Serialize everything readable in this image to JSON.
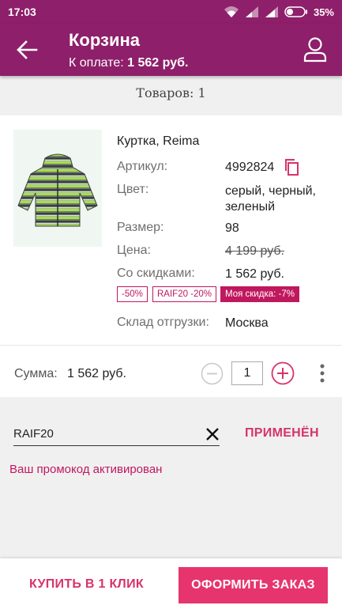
{
  "status_bar": {
    "time": "17:03",
    "battery": "35%"
  },
  "app_bar": {
    "title": "Корзина",
    "subtitle_label": "К оплате:",
    "subtitle_value": "1 562 руб."
  },
  "items_count": "Товаров: 1",
  "product": {
    "name": "Куртка, Reima",
    "fields": {
      "article_label": "Артикул:",
      "article_value": "4992824",
      "color_label": "Цвет:",
      "color_value_1": "серый, черный,",
      "color_value_2": "зеленый",
      "size_label": "Размер:",
      "size_value": "98",
      "price_label": "Цена:",
      "price_value": "4 199 руб.",
      "discount_label": "Со скидками:",
      "discount_value": "1 562 руб.",
      "warehouse_label": "Склад отгрузки:",
      "warehouse_value": "Москва"
    },
    "tags": [
      "-50%",
      "RAIF20 -20%",
      "Моя скидка: -7%"
    ]
  },
  "summary": {
    "label": "Сумма:",
    "value": "1 562 руб.",
    "quantity": "1"
  },
  "promo": {
    "code": "RAIF20",
    "apply_label": "ПРИМЕНЁН",
    "message": "Ваш промокод активирован"
  },
  "actions": {
    "buy_one_click": "КУПИТЬ В 1 КЛИК",
    "checkout": "ОФОРМИТЬ ЗАКАЗ"
  },
  "colors": {
    "primary": "#8e1f6a",
    "accent": "#d6336c",
    "checkout_bg": "#e6356e"
  }
}
